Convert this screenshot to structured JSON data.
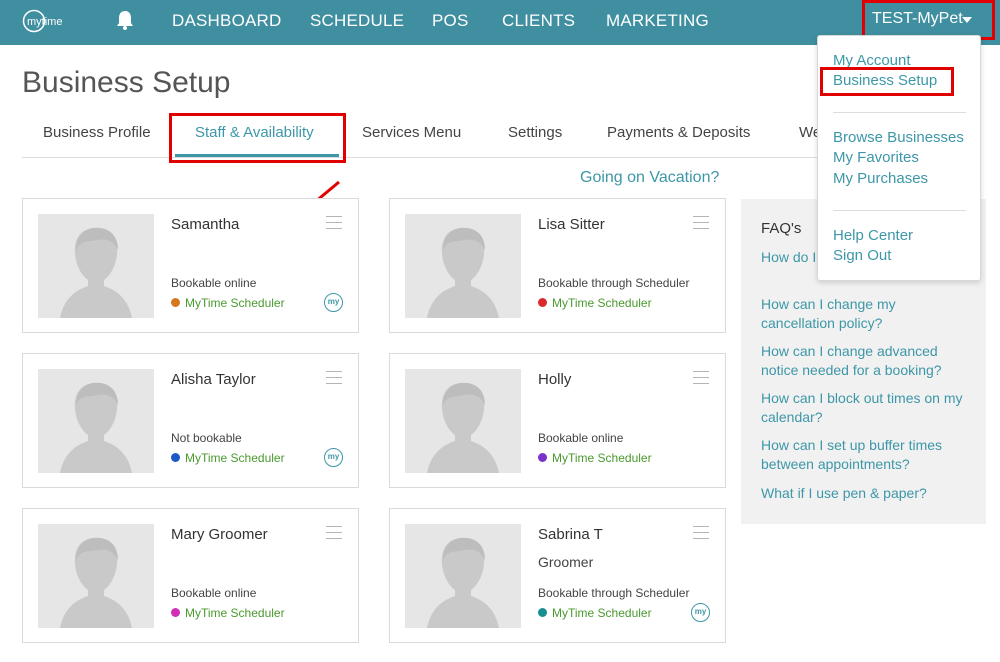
{
  "header": {
    "logo_text": "mytime",
    "nav": [
      "DASHBOARD",
      "SCHEDULE",
      "POS",
      "CLIENTS",
      "MARKETING"
    ],
    "account": "TEST-MyPet"
  },
  "page": {
    "title": "Business Setup",
    "tabs": [
      "Business Profile",
      "Staff & Availability",
      "Services Menu",
      "Settings",
      "Payments & Deposits",
      "We"
    ],
    "active_tab": "Staff & Availability",
    "vacation_link": "Going on Vacation?"
  },
  "staff": [
    {
      "name": "Samantha",
      "role": "",
      "status": "Bookable online",
      "scheduler": "MyTime Scheduler",
      "dot_color": "#d4771f",
      "badge": "my"
    },
    {
      "name": "Lisa Sitter",
      "role": "",
      "status": "Bookable through Scheduler",
      "scheduler": "MyTime Scheduler",
      "dot_color": "#d92b2b",
      "badge": ""
    },
    {
      "name": "Alisha Taylor",
      "role": "",
      "status": "Not bookable",
      "scheduler": "MyTime Scheduler",
      "dot_color": "#1f58c7",
      "badge": "my"
    },
    {
      "name": "Holly",
      "role": "",
      "status": "Bookable online",
      "scheduler": "MyTime Scheduler",
      "dot_color": "#7a33c9",
      "badge": ""
    },
    {
      "name": "Mary Groomer",
      "role": "",
      "status": "Bookable online",
      "scheduler": "MyTime Scheduler",
      "dot_color": "#d22db5",
      "badge": ""
    },
    {
      "name": "Sabrina T",
      "role": "Groomer",
      "status": "Bookable through Scheduler",
      "scheduler": "MyTime Scheduler",
      "dot_color": "#178f8f",
      "badge": "my"
    }
  ],
  "faq": {
    "title": "FAQ's",
    "links": [
      "How do I edit my business ...",
      "How can I change my cancellation policy?",
      "How can I change advanced notice needed for a booking?",
      "How can I block out times on my calendar?",
      "How can I set up buffer times between appointments?",
      "What if I use pen & paper?"
    ]
  },
  "dropdown": {
    "items": [
      "My Account",
      "Business Setup",
      "Browse Businesses",
      "My Favorites",
      "My Purchases",
      "Help Center",
      "Sign Out"
    ]
  },
  "colors": {
    "header_bg": "#3f8fa0",
    "accent": "#3d97a8",
    "highlight_red": "#e00000",
    "scheduler_green": "#4a9a2f"
  }
}
